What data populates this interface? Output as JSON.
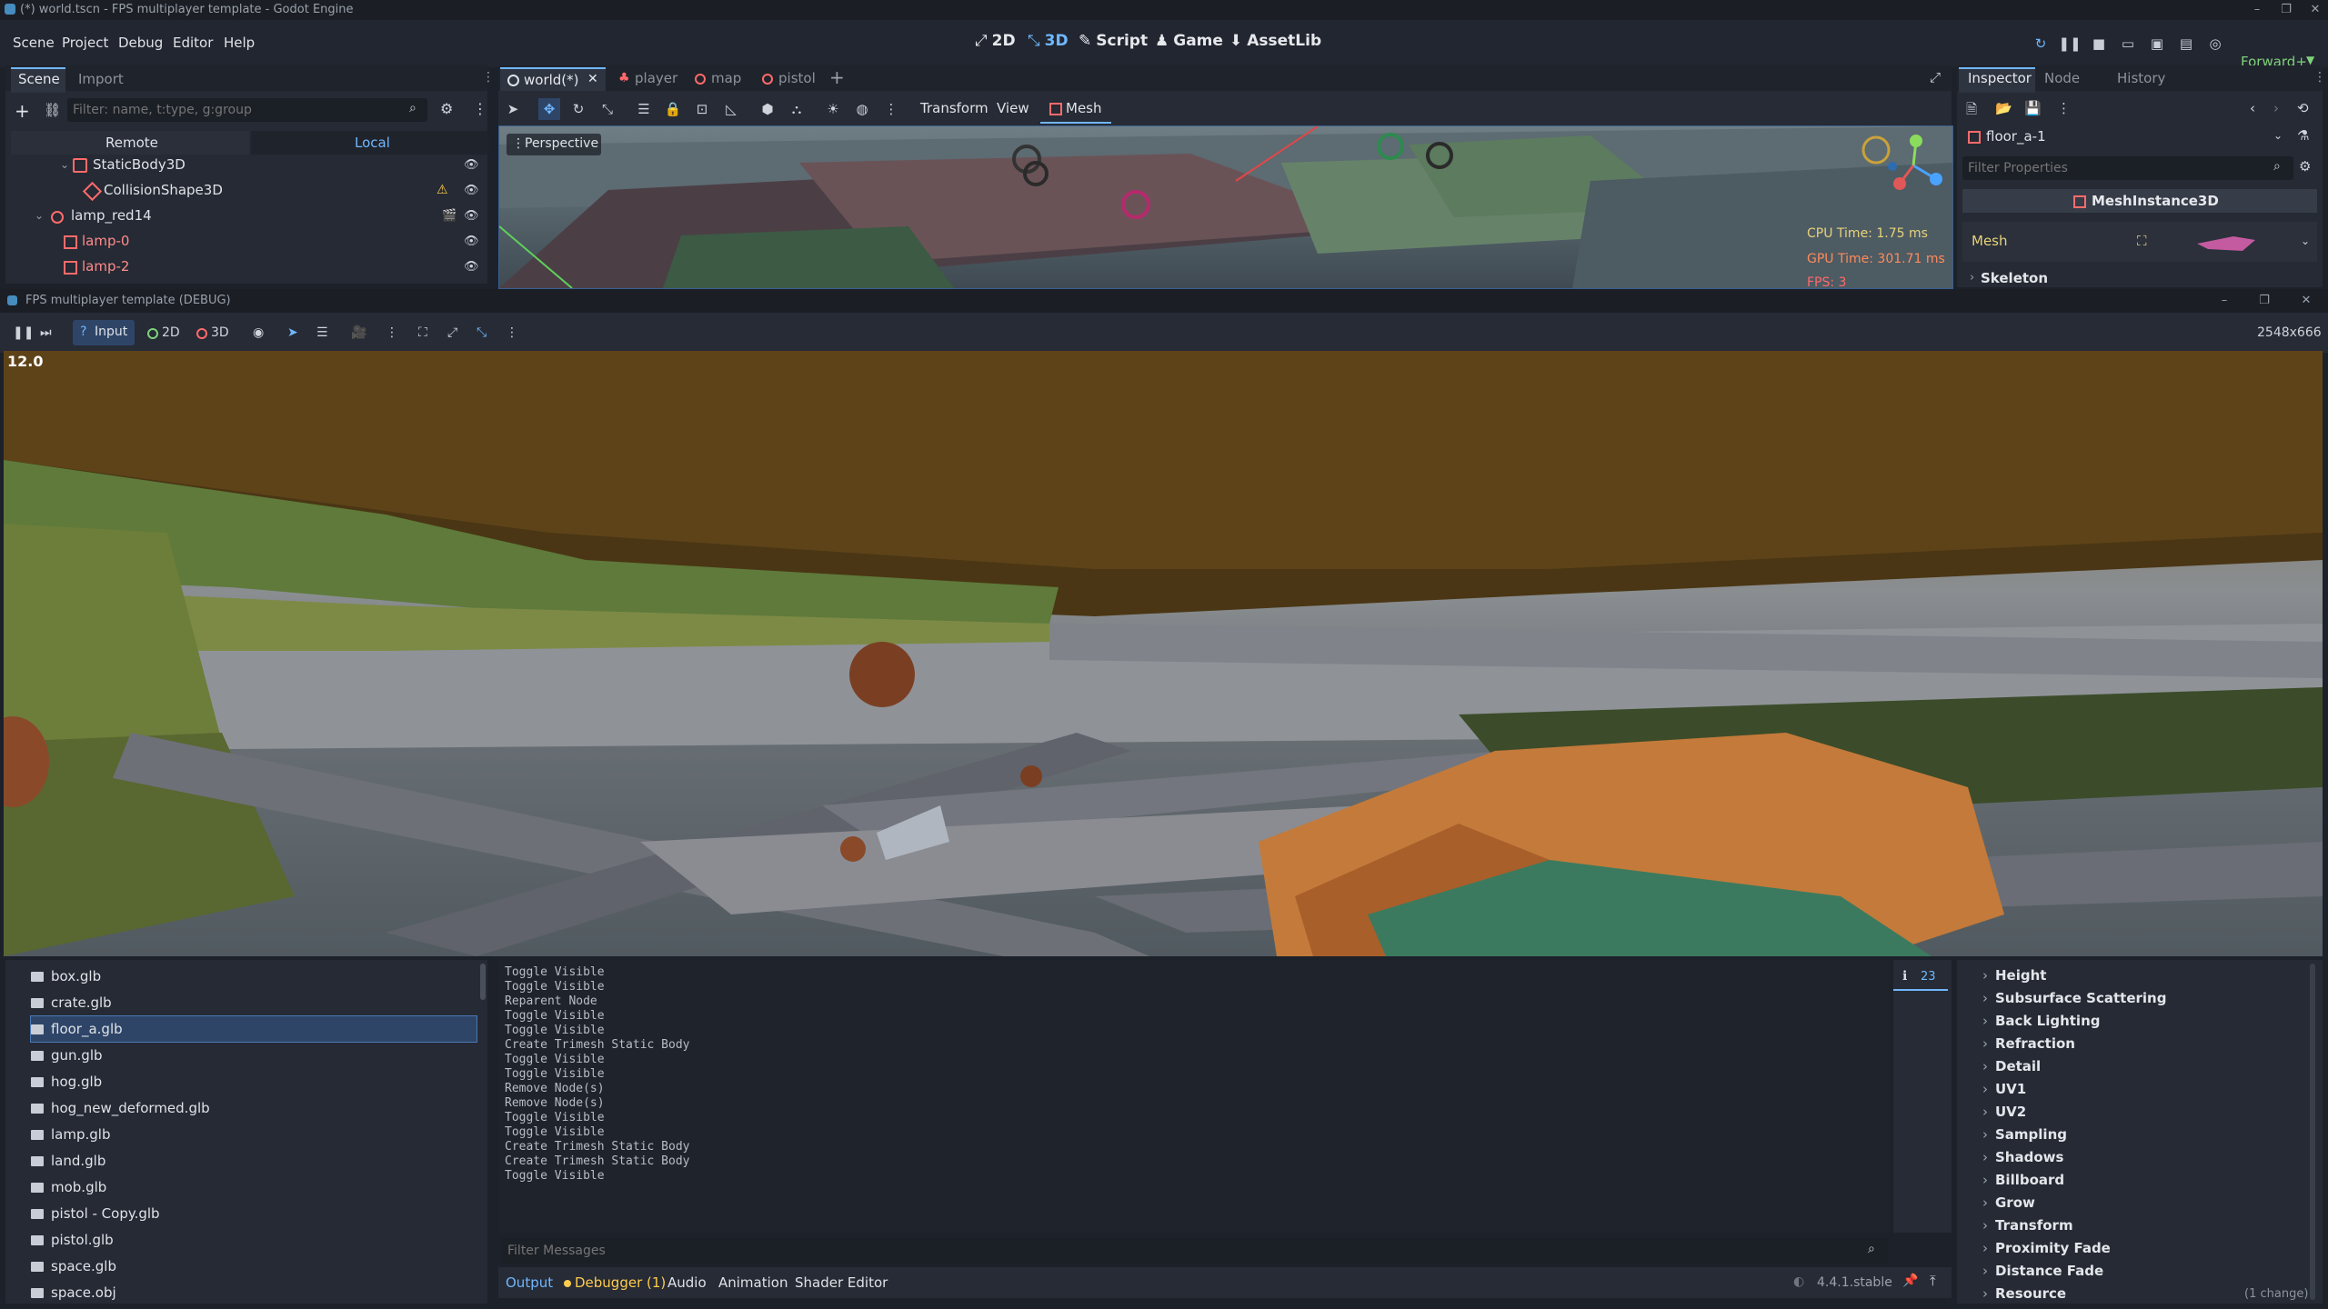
{
  "window": {
    "title": "(*) world.tscn - FPS multiplayer template - Godot Engine",
    "icon": "godot-icon"
  },
  "menu": [
    "Scene",
    "Project",
    "Debug",
    "Editor",
    "Help"
  ],
  "workspaces": [
    {
      "label": "2D",
      "icon": "2d-icon"
    },
    {
      "label": "3D",
      "icon": "3d-icon",
      "active": true
    },
    {
      "label": "Script",
      "icon": "script-icon"
    },
    {
      "label": "Game",
      "icon": "game-icon"
    },
    {
      "label": "AssetLib",
      "icon": "assetlib-icon"
    }
  ],
  "renderer": "Forward+",
  "scene_dock": {
    "tabs": [
      "Scene",
      "Import"
    ],
    "filter_placeholder": "Filter: name, t:type, g:group",
    "remote_label": "Remote",
    "local_label": "Local",
    "tree": [
      "StaticBody3D",
      "CollisionShape3D",
      "lamp_red14",
      "lamp-0",
      "lamp-2"
    ]
  },
  "editor_tabs": [
    "world(*)",
    "player",
    "map",
    "pistol"
  ],
  "viewport_menus": [
    "Transform",
    "View",
    "Mesh"
  ],
  "viewport": {
    "perspective_label": "Perspective",
    "cpu_time": "CPU Time: 1.75 ms",
    "gpu_time": "GPU Time: 301.71 ms",
    "fps": "FPS: 3"
  },
  "inspector": {
    "tabs": [
      "Inspector",
      "Node",
      "History"
    ],
    "object": "floor_a-1",
    "filter_placeholder": "Filter Properties",
    "class_name": "MeshInstance3D",
    "mesh_label": "Mesh",
    "skeleton_label": "Skeleton",
    "sections": [
      "Height",
      "Subsurface Scattering",
      "Back Lighting",
      "Refraction",
      "Detail",
      "UV1",
      "UV2",
      "Sampling",
      "Shadows",
      "Billboard",
      "Grow",
      "Transform",
      "Proximity Fade",
      "Distance Fade",
      "Resource"
    ],
    "change_note": "(1 change)"
  },
  "game_window": {
    "title": "FPS multiplayer template (DEBUG)",
    "input_label": "Input",
    "mode_2d": "2D",
    "mode_3d": "3D",
    "resolution": "2548x666",
    "overlay_value": "12.0"
  },
  "filesystem": {
    "files": [
      "box.glb",
      "crate.glb",
      "floor_a.glb",
      "gun.glb",
      "hog.glb",
      "hog_new_deformed.glb",
      "lamp.glb",
      "land.glb",
      "mob.glb",
      "pistol - Copy.glb",
      "pistol.glb",
      "space.glb",
      "space.obj"
    ],
    "selected": "floor_a.glb"
  },
  "output": {
    "lines": [
      "Toggle Visible",
      "Toggle Visible",
      "Reparent Node",
      "Toggle Visible",
      "Toggle Visible",
      "Create Trimesh Static Body",
      "Toggle Visible",
      "Toggle Visible",
      "Remove Node(s)",
      "Remove Node(s)",
      "Toggle Visible",
      "Toggle Visible",
      "Create Trimesh Static Body",
      "Create Trimesh Static Body",
      "Toggle Visible"
    ],
    "count": "23",
    "filter_placeholder": "Filter Messages"
  },
  "bottom_tabs": [
    "Output",
    "Debugger (1)",
    "Audio",
    "Animation",
    "Shader Editor"
  ],
  "version": "4.4.1.stable",
  "colors": {
    "accent": "#70b7ff",
    "bg": "#1d2129",
    "panel": "#262b35",
    "warning": "#ffcc4d"
  }
}
